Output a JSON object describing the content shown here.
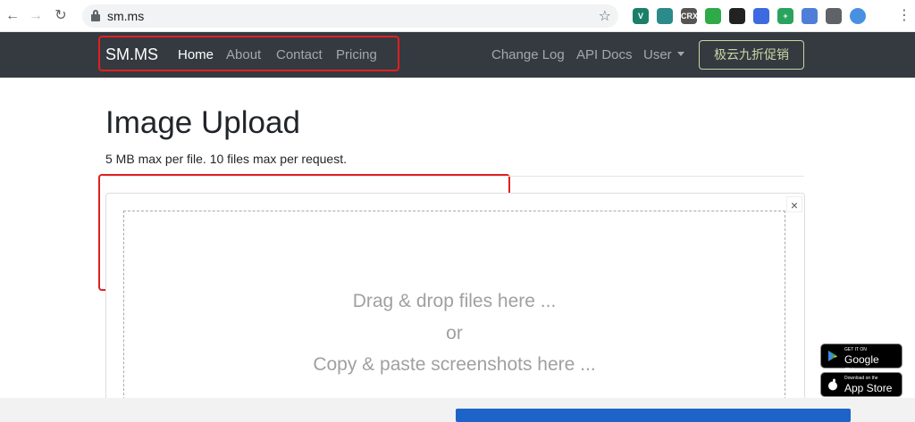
{
  "browser": {
    "url": "sm.ms",
    "back_icon": "back-arrow-icon",
    "forward_icon": "forward-arrow-icon",
    "reload_icon": "reload-icon",
    "extensions": [
      {
        "name": "vue-devtools-icon",
        "label": "V",
        "color": "#1a7f6a"
      },
      {
        "name": "globe-extension-icon",
        "label": "",
        "color": "#2b8a8a"
      },
      {
        "name": "crx-extension-icon",
        "label": "CRX",
        "color": "#555555"
      },
      {
        "name": "gear-green-icon",
        "label": "",
        "color": "#2eaa46"
      },
      {
        "name": "dark-square-icon",
        "label": "",
        "color": "#222222"
      },
      {
        "name": "translate-icon",
        "label": "",
        "color": "#3d6ae0"
      },
      {
        "name": "plus-square-icon",
        "label": "+",
        "color": "#2aa35e"
      },
      {
        "name": "blue-circle-icon",
        "label": "",
        "color": "#4f7ed8"
      },
      {
        "name": "puzzle-icon",
        "label": "",
        "color": "#5f6368"
      },
      {
        "name": "profile-avatar-icon",
        "label": "",
        "color": "#4a90e2"
      }
    ]
  },
  "navbar": {
    "brand": "SM.MS",
    "left_links": [
      "Home",
      "About",
      "Contact",
      "Pricing"
    ],
    "right_links": [
      "Change Log",
      "API Docs",
      "User"
    ],
    "promo_button": "极云九折促销"
  },
  "main": {
    "title": "Image Upload",
    "subtitle": "5 MB max per file. 10 files max per request.",
    "drop_line1": "Drag & drop files here ...",
    "drop_line2": "or",
    "drop_line3": "Copy & paste screenshots here ...",
    "close_label": "×"
  },
  "badges": {
    "google_small": "GET IT ON",
    "google_big": "Google Play",
    "apple_small": "Download on the",
    "apple_big": "App Store"
  },
  "colors": {
    "navbar_bg": "#343a40",
    "annotation_red": "#e02020",
    "promo_outline": "#c9d6a3"
  }
}
